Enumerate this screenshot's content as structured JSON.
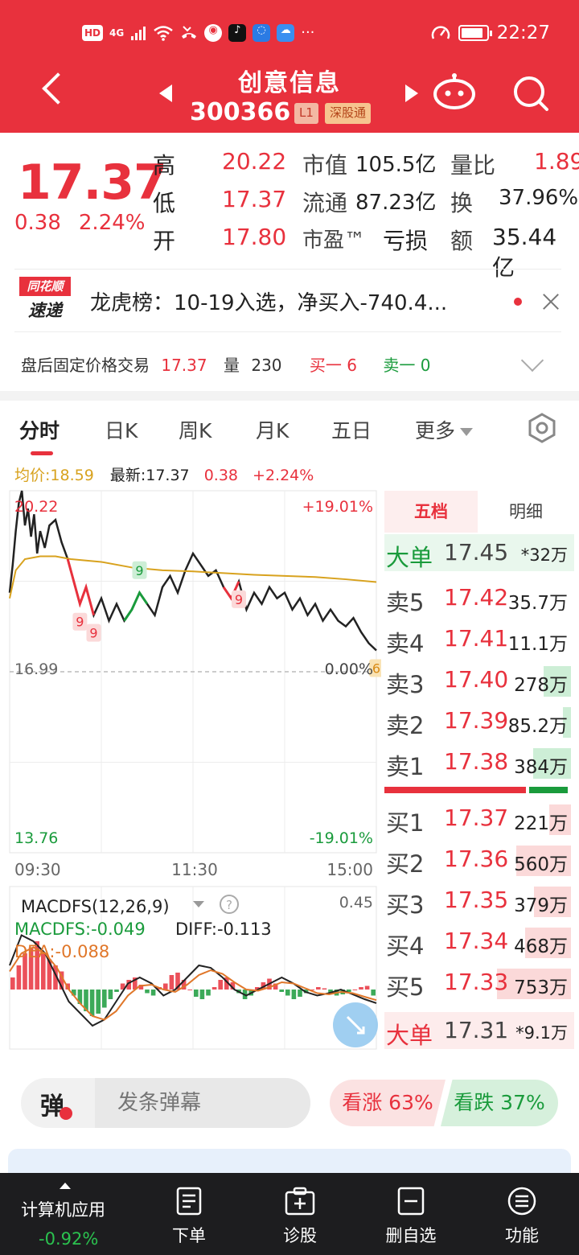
{
  "status_bar": {
    "left_icons": [
      "HD",
      "4G",
      "signal-icon",
      "wifi-icon",
      "missed-call-icon",
      "browser-icon",
      "tiktok-icon",
      "bulb-icon",
      "cloud-icon",
      "more-icon"
    ],
    "time": "22:27"
  },
  "header": {
    "name": "创意信息",
    "code": "300366",
    "tag_l1": "L1",
    "tag_market": "深股通",
    "bg_color": "#e8313d"
  },
  "quote": {
    "price": "17.37",
    "change": "0.38",
    "change_pct": "2.24%",
    "high_label": "高",
    "high": "20.22",
    "low_label": "低",
    "low": "17.37",
    "open_label": "开",
    "open": "17.80",
    "mktcap_label": "市值",
    "mktcap": "105.5亿",
    "float_label": "流通",
    "float": "87.23亿",
    "pe_label": "市盈™",
    "pe": "亏损",
    "vol_ratio_label": "量比",
    "vol_ratio": "1.89",
    "turnover_label": "换",
    "turnover": "37.96%",
    "amount_label": "额",
    "amount": "35.44亿"
  },
  "news": {
    "logo_top": "同花顺",
    "logo_bottom": "速递",
    "text": "龙虎榜：10-19入选，净买入-740.4..."
  },
  "after_hours": {
    "label": "盘后固定价格交易",
    "price": "17.37",
    "vol_label": "量",
    "vol": "230",
    "buy1": "买一 6",
    "sell1": "卖一 0"
  },
  "tabs": [
    {
      "label": "分时",
      "active": true
    },
    {
      "label": "日K"
    },
    {
      "label": "周K"
    },
    {
      "label": "月K"
    },
    {
      "label": "五日"
    },
    {
      "label": "更多"
    }
  ],
  "avg_row": {
    "avg": "均价:18.59",
    "latest": "最新:17.37",
    "chg": "0.38",
    "pct": "+2.24%"
  },
  "chart_data": [
    {
      "type": "line",
      "title": "分时",
      "y_top_label": "20.22",
      "y_mid_label": "16.99",
      "y_bottom_label": "13.76",
      "pct_top_label": "+19.01%",
      "pct_mid_label": "0.00%",
      "pct_bottom_label": "-19.01%",
      "x_tick_labels": [
        "09:30",
        "11:30",
        "15:00"
      ],
      "ylim": [
        13.76,
        20.22
      ],
      "grid": true,
      "series": [
        {
          "name": "price",
          "color": "#222222",
          "x": [
            0,
            2,
            4,
            6,
            8,
            10,
            12,
            14,
            16,
            18,
            20,
            23,
            26,
            30,
            34,
            38,
            42,
            46,
            50,
            55,
            60,
            65,
            70,
            75,
            80,
            85,
            90,
            95,
            100,
            105,
            110,
            115,
            120,
            125,
            130,
            135,
            140,
            145,
            150,
            155,
            160,
            165,
            170,
            175,
            180,
            185,
            190,
            195,
            200,
            205,
            210,
            215,
            220,
            225,
            230,
            235,
            240
          ],
          "values": [
            18.4,
            18.9,
            19.5,
            20.0,
            20.22,
            19.6,
            19.9,
            19.4,
            19.8,
            19.1,
            19.5,
            19.2,
            19.6,
            19.7,
            19.3,
            19.0,
            18.6,
            18.2,
            18.5,
            18.0,
            18.3,
            17.9,
            18.2,
            17.9,
            18.1,
            18.4,
            18.2,
            18.0,
            18.5,
            18.7,
            18.4,
            18.8,
            19.1,
            18.9,
            18.7,
            18.8,
            18.5,
            18.3,
            18.6,
            18.1,
            18.4,
            18.2,
            18.5,
            18.3,
            18.4,
            18.1,
            18.3,
            18.0,
            18.2,
            17.9,
            18.1,
            17.9,
            17.8,
            17.95,
            17.7,
            17.5,
            17.37
          ]
        },
        {
          "name": "avg",
          "color": "#d8a21e",
          "x": [
            0,
            4,
            10,
            20,
            30,
            40,
            60,
            80,
            100,
            120,
            140,
            160,
            180,
            200,
            220,
            240
          ],
          "values": [
            18.3,
            18.8,
            19.0,
            19.05,
            19.05,
            19.0,
            18.95,
            18.85,
            18.8,
            18.78,
            18.75,
            18.72,
            18.7,
            18.68,
            18.64,
            18.59
          ]
        }
      ],
      "markers": [
        {
          "label": "9",
          "x": 46,
          "value": 18.2,
          "kind": "red"
        },
        {
          "label": "9",
          "x": 55,
          "value": 18.0,
          "kind": "red"
        },
        {
          "label": "9",
          "x": 85,
          "value": 18.4,
          "kind": "green"
        },
        {
          "label": "9",
          "x": 150,
          "value": 18.6,
          "kind": "red"
        },
        {
          "label": "6",
          "x": 240,
          "value": 17.37,
          "kind": "orange"
        }
      ]
    },
    {
      "type": "bar",
      "title": "MACDFS(12,26,9)",
      "ylabel_top": "0.45",
      "macdfs_label": "MACDFS:-0.049",
      "diff_label": "DIFF:-0.113",
      "dea_label": "DEA:-0.088",
      "series": [
        {
          "name": "MACDFS",
          "values": [
            0.1,
            0.2,
            0.3,
            0.35,
            0.4,
            0.3,
            0.25,
            0.2,
            0.15,
            0.05,
            -0.05,
            -0.12,
            -0.18,
            -0.22,
            -0.2,
            -0.15,
            -0.08,
            -0.02,
            0.05,
            0.08,
            0.1,
            0.04,
            -0.03,
            -0.05,
            0.02,
            0.05,
            0.12,
            0.14,
            0.08,
            0.0,
            -0.06,
            -0.08,
            -0.05,
            0.02,
            0.08,
            0.1,
            0.06,
            -0.03,
            -0.08,
            -0.05,
            0.02,
            0.06,
            0.09,
            0.05,
            -0.02,
            -0.05,
            -0.08,
            -0.06,
            -0.03,
            0.0,
            0.02,
            0.01,
            -0.03,
            -0.05,
            -0.04,
            -0.02,
            0.0,
            0.02,
            0.03,
            -0.05
          ]
        },
        {
          "name": "DIFF",
          "color": "#222222",
          "values": [
            0.2,
            0.45,
            0.4,
            0.3,
            0.1,
            -0.1,
            -0.2,
            -0.3,
            -0.25,
            -0.1,
            0.05,
            0.1,
            0.05,
            -0.05,
            0.0,
            0.1,
            0.2,
            0.18,
            0.1,
            0.0,
            -0.05,
            0.0,
            0.05,
            0.1,
            0.05,
            -0.02,
            -0.05,
            -0.03,
            0.0,
            -0.04,
            -0.08,
            -0.113
          ]
        },
        {
          "name": "DEA",
          "color": "#e0772a",
          "values": [
            0.15,
            0.3,
            0.35,
            0.3,
            0.18,
            0.0,
            -0.12,
            -0.22,
            -0.25,
            -0.18,
            -0.05,
            0.03,
            0.04,
            0.0,
            -0.02,
            0.04,
            0.12,
            0.16,
            0.13,
            0.06,
            0.0,
            -0.01,
            0.02,
            0.06,
            0.05,
            0.01,
            -0.03,
            -0.04,
            -0.02,
            -0.03,
            -0.06,
            -0.088
          ]
        }
      ]
    }
  ],
  "order_book": {
    "tab1": "五档",
    "tab2": "明细",
    "big_sell": {
      "label": "大单",
      "price": "17.45",
      "vol": "*32万"
    },
    "asks": [
      {
        "label": "卖5",
        "price": "17.42",
        "vol": "35.7万",
        "bar": 0.0
      },
      {
        "label": "卖4",
        "price": "17.41",
        "vol": "11.1万",
        "bar": 0.0
      },
      {
        "label": "卖3",
        "price": "17.40",
        "vol": "278万",
        "bar": 0.37
      },
      {
        "label": "卖2",
        "price": "17.39",
        "vol": "85.2万",
        "bar": 0.11
      },
      {
        "label": "卖1",
        "price": "17.38",
        "vol": "384万",
        "bar": 0.51
      }
    ],
    "bids": [
      {
        "label": "买1",
        "price": "17.37",
        "vol": "221万",
        "bar": 0.29
      },
      {
        "label": "买2",
        "price": "17.36",
        "vol": "560万",
        "bar": 0.74
      },
      {
        "label": "买3",
        "price": "17.35",
        "vol": "379万",
        "bar": 0.5
      },
      {
        "label": "买4",
        "price": "17.34",
        "vol": "468万",
        "bar": 0.62
      },
      {
        "label": "买5",
        "price": "17.33",
        "vol": "753万",
        "bar": 1.0
      }
    ],
    "big_buy": {
      "label": "大单",
      "price": "17.31",
      "vol": "*9.1万"
    },
    "bid_ask_ratio": 0.78
  },
  "danmu": {
    "icon": "弹",
    "placeholder": "发条弹幕"
  },
  "sentiment": {
    "bull": "看涨 63%",
    "bear": "看跌 37%"
  },
  "bottom_nav": {
    "sector": "计算机应用",
    "sector_chg": "-0.92%",
    "items": [
      {
        "label": "下单",
        "icon": "order-icon"
      },
      {
        "label": "诊股",
        "icon": "diagnose-icon"
      },
      {
        "label": "删自选",
        "icon": "remove-watchlist-icon"
      },
      {
        "label": "功能",
        "icon": "menu-icon"
      }
    ]
  }
}
